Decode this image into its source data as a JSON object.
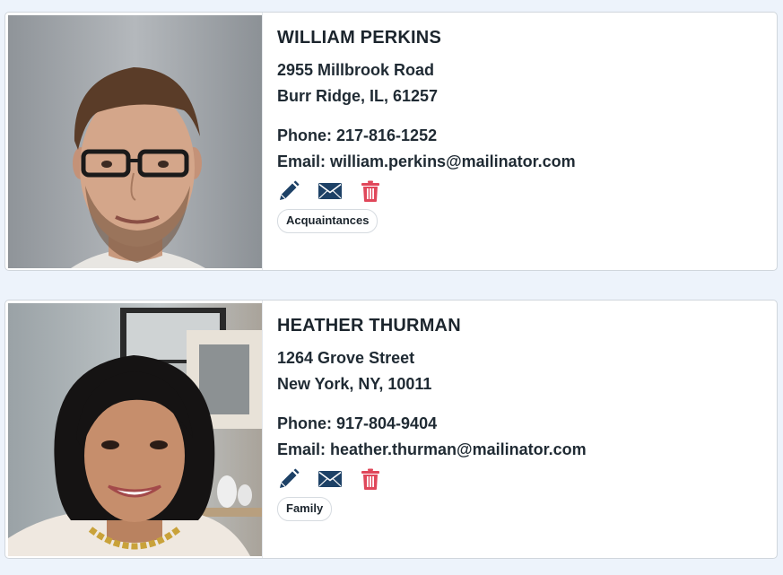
{
  "contacts": [
    {
      "name": "WILLIAM PERKINS",
      "address_line1": "2955 Millbrook Road",
      "address_line2": "Burr Ridge, IL, 61257",
      "phone": "Phone: 217-816-1252",
      "email": "Email: william.perkins@mailinator.com",
      "tag": "Acquaintances"
    },
    {
      "name": "HEATHER THURMAN",
      "address_line1": "1264 Grove Street",
      "address_line2": "New York, NY, 10011",
      "phone": "Phone: 917-804-9404",
      "email": "Email: heather.thurman@mailinator.com",
      "tag": "Family"
    }
  ],
  "icons": {
    "edit": "pencil-icon",
    "email": "envelope-icon",
    "delete": "trash-icon"
  },
  "colors": {
    "page_background": "#edf3fb",
    "icon_primary": "#1d4166",
    "icon_delete": "#e0475a"
  }
}
